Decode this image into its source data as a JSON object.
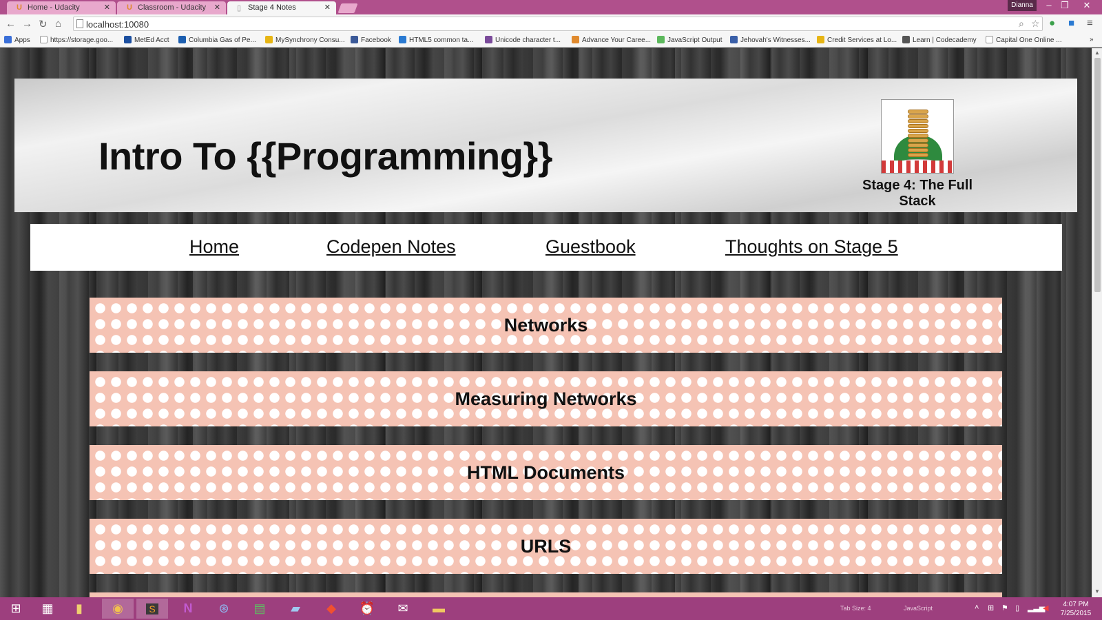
{
  "browser": {
    "tabs": [
      {
        "label": "Home - Udacity",
        "active": false
      },
      {
        "label": "Classroom - Udacity",
        "active": false
      },
      {
        "label": "Stage 4 Notes",
        "active": true
      }
    ],
    "user": "Dianna",
    "url": "localhost:10080",
    "bookmarks": [
      {
        "label": "Apps",
        "color": "#3a6fd8"
      },
      {
        "label": "https://storage.goo...",
        "color": "#ffffff"
      },
      {
        "label": "MetEd Acct",
        "color": "#1c4fa0"
      },
      {
        "label": "Columbia Gas of Pe...",
        "color": "#1d5fb0"
      },
      {
        "label": "MySynchrony Consu...",
        "color": "#e7b514"
      },
      {
        "label": "Facebook",
        "color": "#3b5998"
      },
      {
        "label": "HTML5 common ta...",
        "color": "#2a7ad2"
      },
      {
        "label": "Unicode character t...",
        "color": "#7a4a9a"
      },
      {
        "label": "Advance Your Caree...",
        "color": "#e08a2e"
      },
      {
        "label": "JavaScript Output",
        "color": "#5cb85c"
      },
      {
        "label": "Jehovah's Witnesses...",
        "color": "#3a5fa8"
      },
      {
        "label": "Credit Services at Lo...",
        "color": "#e7b514"
      },
      {
        "label": "Learn | Codecademy",
        "color": "#555555"
      },
      {
        "label": "Capital One Online ...",
        "color": "#ffffff"
      }
    ]
  },
  "page": {
    "title": "Intro To {{Programming}}",
    "stage": "Stage 4: The Full Stack",
    "nav": [
      "Home",
      "Codepen Notes",
      "Guestbook",
      "Thoughts on Stage 5"
    ],
    "topics": [
      "Networks",
      "Measuring Networks",
      "HTML Documents",
      "URLS"
    ]
  },
  "taskbar": {
    "status_tab_size": "Tab Size: 4",
    "status_lang": "JavaScript",
    "time": "4:07 PM",
    "date": "7/25/2015"
  },
  "colors": {
    "tab_bar": "#b0508c",
    "taskbar": "#9d3f7e",
    "topic_bg": "#f5c3b4"
  }
}
